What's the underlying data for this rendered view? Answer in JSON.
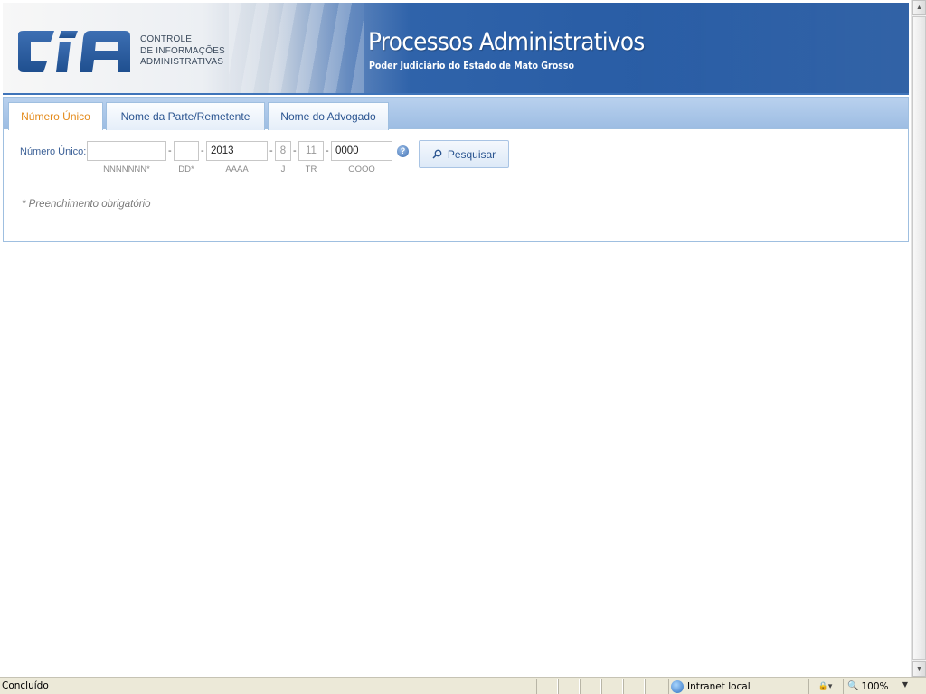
{
  "header": {
    "logo_line1": "CONTROLE",
    "logo_line2": "DE INFORMAÇÕES",
    "logo_line3": "ADMINISTRATIVAS",
    "title": "Processos Administrativos",
    "subtitle": "Poder Judiciário do Estado de Mato Grosso"
  },
  "tabs": [
    {
      "label": "Número Único",
      "active": true
    },
    {
      "label": "Nome da Parte/Remetente",
      "active": false
    },
    {
      "label": "Nome do Advogado",
      "active": false
    }
  ],
  "form": {
    "field_label": "Número Único:",
    "segments": [
      {
        "value": "",
        "hint": "NNNNNNN*"
      },
      {
        "value": "",
        "hint": "DD*"
      },
      {
        "value": "2013",
        "hint": "AAAA"
      },
      {
        "value": "8",
        "hint": "J"
      },
      {
        "value": "11",
        "hint": "TR"
      },
      {
        "value": "0000",
        "hint": "OOOO"
      }
    ],
    "separator": "-",
    "help_icon": "question-circle-icon",
    "search_label": "Pesquisar",
    "search_icon": "magnifier-icon",
    "required_note": "* Preenchimento obrigatório"
  },
  "statusbar": {
    "text": "Concluído",
    "zone": "Intranet local",
    "zoom": "100%"
  },
  "colors": {
    "banner_blue": "#2a5ea6",
    "tab_active_text": "#e48a1a",
    "tab_text": "#2a5490",
    "label_text": "#3a5f96"
  }
}
